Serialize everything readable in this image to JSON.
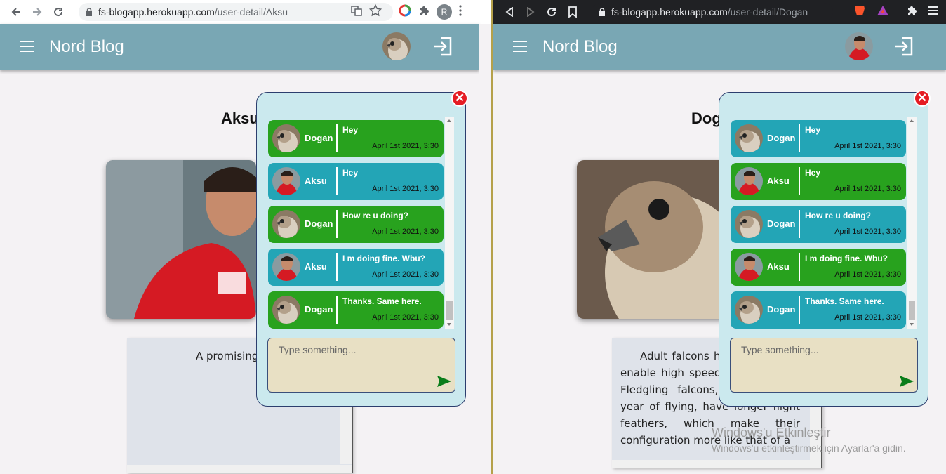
{
  "left": {
    "url_host": "fs-blogapp.herokuapp.com",
    "url_path": "/user-detail/Aksu",
    "profile_initial": "R",
    "brand": "Nord Blog",
    "username": "Aksu",
    "description": "A promising st",
    "top_avatar": "falcon",
    "photo": "cantona"
  },
  "right": {
    "url_host": "fs-blogapp.herokuapp.com",
    "url_path": "/user-detail/Dogan",
    "brand": "Nord Blog",
    "username": "Dogan",
    "description": "Adult falcons ha wings, which enable high speed and c rapidly. Fledgling falcons, in their first year of flying, have longer flight feathers, which make their configuration more like that of a",
    "top_avatar": "cantona",
    "photo": "falcon"
  },
  "chat": {
    "messages": [
      {
        "name": "Dogan",
        "text": "Hey",
        "time": "April 1st 2021, 3:30",
        "avatar": "falcon"
      },
      {
        "name": "Aksu",
        "text": "Hey",
        "time": "April 1st 2021, 3:30",
        "avatar": "cantona"
      },
      {
        "name": "Dogan",
        "text": "How re u doing?",
        "time": "April 1st 2021, 3:30",
        "avatar": "falcon"
      },
      {
        "name": "Aksu",
        "text": "I m doing fine. Wbu?",
        "time": "April 1st 2021, 3:30",
        "avatar": "cantona"
      },
      {
        "name": "Dogan",
        "text": "Thanks. Same here.",
        "time": "April 1st 2021, 3:30",
        "avatar": "falcon"
      }
    ],
    "placeholder": "Type something...",
    "close_label": "✕",
    "colors": {
      "green": "#28a21e",
      "teal": "#23a5b6"
    }
  },
  "watermark": {
    "line1": "Windows'u Etkinleştir",
    "line2": "Windows'u etkinleştirmek için Ayarlar'a gidin."
  }
}
